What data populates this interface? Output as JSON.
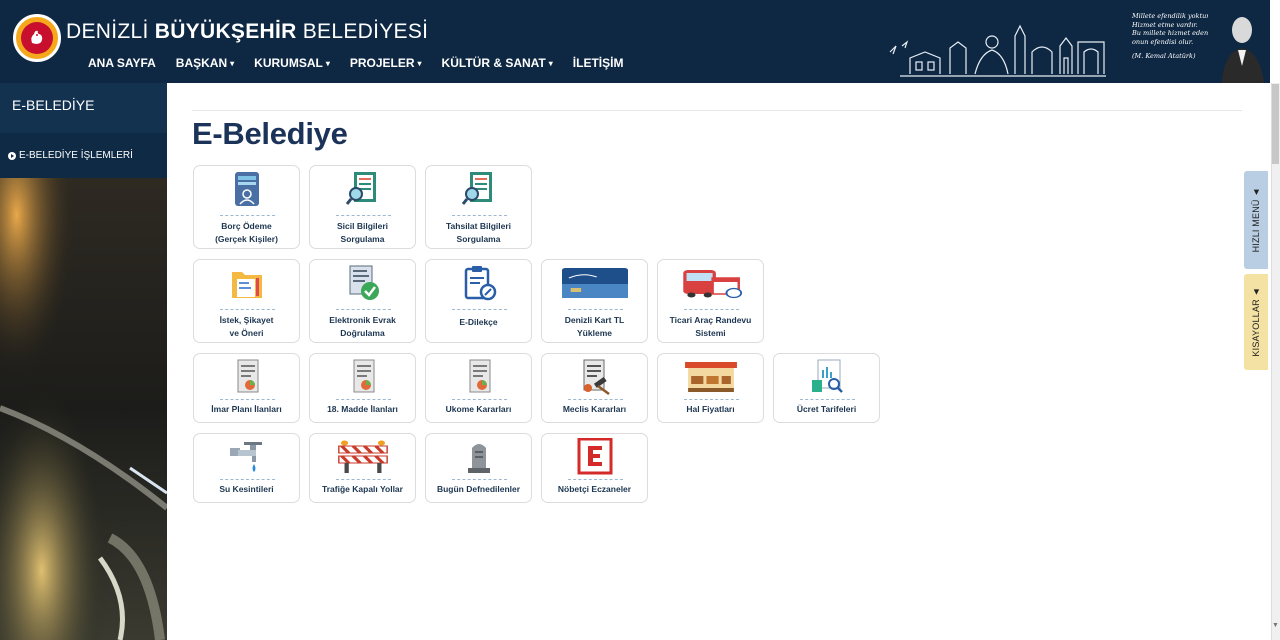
{
  "header": {
    "title_prefix": "DENİZLİ ",
    "title_bold": "BÜYÜKŞEHİR",
    "title_suffix": " BELEDİYESİ",
    "nav": [
      {
        "label": "ANA SAYFA",
        "dropdown": false
      },
      {
        "label": "BAŞKAN",
        "dropdown": true
      },
      {
        "label": "KURUMSAL",
        "dropdown": true
      },
      {
        "label": "PROJELER",
        "dropdown": true
      },
      {
        "label": "KÜLTÜR & SANAT",
        "dropdown": true
      },
      {
        "label": "İLETİŞİM",
        "dropdown": false
      }
    ],
    "quote_lines": [
      "Millete efendilik yoktur.",
      "Hizmet etme vardır.",
      "Bu millete hizmet eden,",
      "onun efendisi olur."
    ],
    "quote_author": "(M. Kemal Atatürk)",
    "caret": "▾"
  },
  "sidebar": {
    "title": "E-BELEDİYE",
    "item": "E-BELEDİYE İŞLEMLERİ"
  },
  "main": {
    "title": "E-Belediye",
    "tiles": [
      {
        "lines": [
          "Borç Ödeme",
          "(Gerçek Kişiler)"
        ],
        "icon": "id-card-icon"
      },
      {
        "lines": [
          "Sicil Bilgileri",
          "Sorgulama"
        ],
        "icon": "document-search-icon"
      },
      {
        "lines": [
          "Tahsilat Bilgileri",
          "Sorgulama"
        ],
        "icon": "document-search-icon"
      },
      {
        "lines": [
          "İstek, Şikayet",
          "ve Öneri"
        ],
        "icon": "folder-document-icon"
      },
      {
        "lines": [
          "Elektronik Evrak",
          "Doğrulama"
        ],
        "icon": "document-check-icon"
      },
      {
        "lines": [
          "E-Dilekçe"
        ],
        "icon": "clipboard-edit-icon"
      },
      {
        "lines": [
          "Denizli Kart TL",
          "Yükleme"
        ],
        "icon": "transit-card-icon"
      },
      {
        "lines": [
          "Ticari Araç Randevu",
          "Sistemi"
        ],
        "icon": "bus-calendar-icon"
      },
      {
        "lines": [
          "İmar Planı İlanları"
        ],
        "icon": "report-chart-icon"
      },
      {
        "lines": [
          "18. Madde İlanları"
        ],
        "icon": "report-chart-icon"
      },
      {
        "lines": [
          "Ukome Kararları"
        ],
        "icon": "report-chart-icon"
      },
      {
        "lines": [
          "Meclis Kararları"
        ],
        "icon": "gavel-document-icon"
      },
      {
        "lines": [
          "Hal Fiyatları"
        ],
        "icon": "market-stall-icon"
      },
      {
        "lines": [
          "Ücret Tarifeleri"
        ],
        "icon": "price-list-icon"
      },
      {
        "lines": [
          "Su Kesintileri"
        ],
        "icon": "water-tap-icon"
      },
      {
        "lines": [
          "Trafiğe Kapalı Yollar"
        ],
        "icon": "road-barrier-icon"
      },
      {
        "lines": [
          "Bugün Defnedilenler"
        ],
        "icon": "gravestone-icon"
      },
      {
        "lines": [
          "Nöbetçi Eczaneler"
        ],
        "icon": "pharmacy-e-icon"
      }
    ]
  },
  "side_tabs": {
    "quick_menu": "HIZLI MENÜ  ◄",
    "shortcuts": "KISAYOLLAR  ◄"
  },
  "colors": {
    "header_bg": "#0e2843",
    "title_blue": "#1b3358",
    "quick_menu_tab": "#b9cee2",
    "shortcuts_tab": "#f3e2a3"
  }
}
